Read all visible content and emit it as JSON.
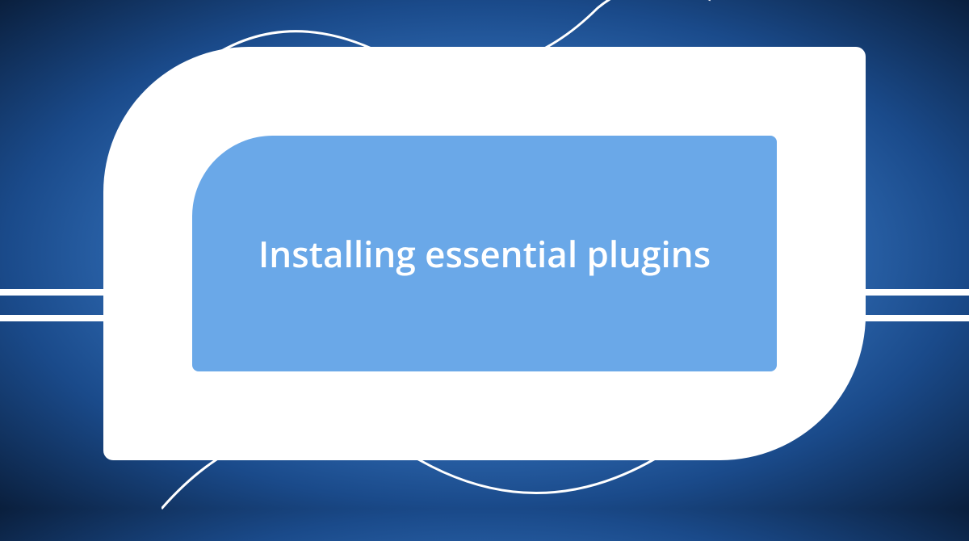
{
  "title": "Installing essential plugins"
}
